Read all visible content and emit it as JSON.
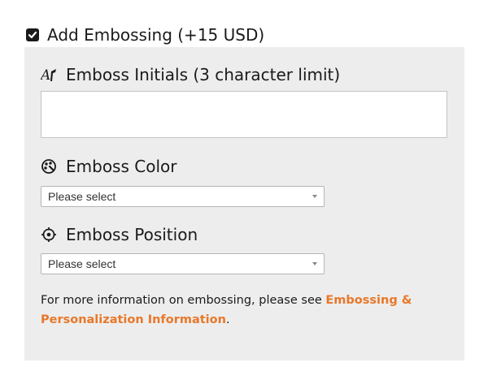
{
  "embossing_toggle": {
    "label": "Add Embossing (+15 USD)",
    "checked": true,
    "icon": "checkbox-checked-icon"
  },
  "initials": {
    "label": "Emboss Initials (3 character limit)",
    "icon": "text-initials-icon",
    "value": "",
    "placeholder": ""
  },
  "color": {
    "label": "Emboss Color",
    "icon": "palette-icon",
    "selected": "Please select"
  },
  "position": {
    "label": "Emboss Position",
    "icon": "crosshair-target-icon",
    "selected": "Please select"
  },
  "info": {
    "text_before": "For more information on embossing, please see ",
    "link_text": "Embossing & Personalization Information",
    "text_after": "."
  },
  "colors": {
    "panel_background": "#ededed",
    "link": "#e8782a",
    "text": "#1a1a1a"
  }
}
